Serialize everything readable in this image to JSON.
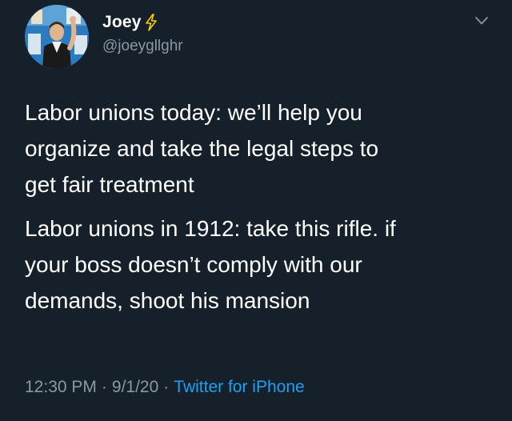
{
  "tweet": {
    "display_name": "Joey",
    "handle": "@joeygllghr",
    "paragraphs": [
      "Labor unions today: we’ll help you\norganize and take the legal steps to\nget fair treatment",
      "Labor unions in 1912: take this rifle. if\nyour boss doesn’t comply with our\ndemands, shoot his mansion"
    ],
    "time": "12:30 PM",
    "separator": "·",
    "date": "9/1/20",
    "source": "Twitter for iPhone"
  },
  "icons": {
    "name_badge": "lightning-bolt-icon",
    "menu": "chevron-down-icon"
  },
  "colors": {
    "background": "#15202b",
    "text": "#ffffff",
    "secondary_text": "#8899a6",
    "link": "#1da1f2",
    "bolt": "#ffcc00"
  }
}
